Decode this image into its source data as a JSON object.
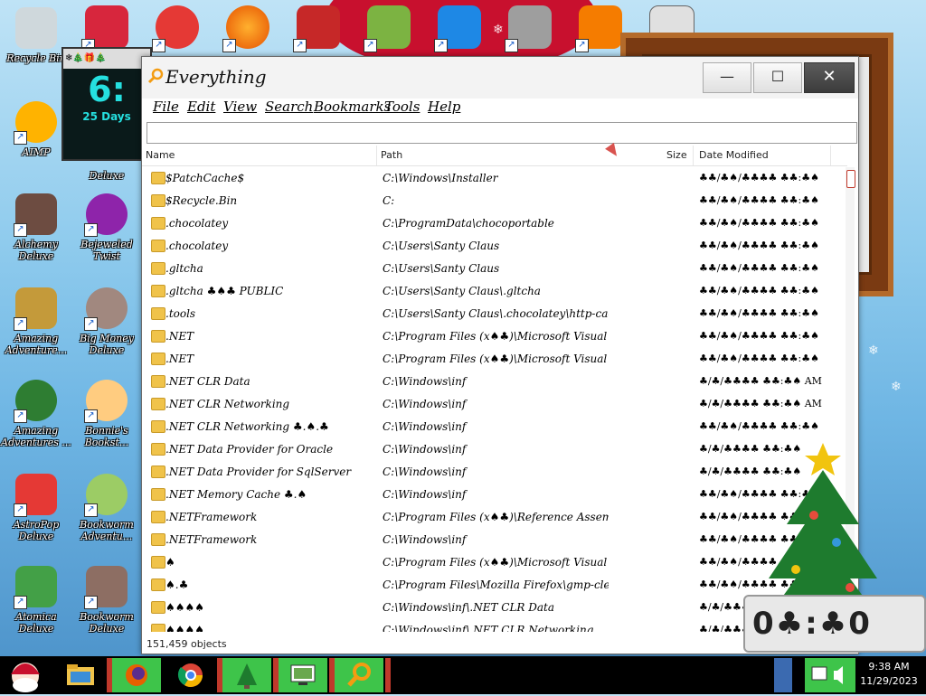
{
  "desktop": {
    "icons": [
      {
        "name": "recycle-bin-icon",
        "label": "Recycle Bin"
      },
      {
        "name": "aimp-icon",
        "label": "AIMP"
      },
      {
        "name": "alchemy-deluxe-icon",
        "label": "Alchemy Deluxe"
      },
      {
        "name": "amazing-adventure-icon",
        "label": "Amazing Adventure..."
      },
      {
        "name": "amazing-adventures2-icon",
        "label": "Amazing Adventures ..."
      },
      {
        "name": "astropop-icon",
        "label": "AstroPop Deluxe"
      },
      {
        "name": "atomica-icon",
        "label": "Atomica Deluxe"
      },
      {
        "name": "bejeweled-twist-icon",
        "label": "Bejeweled Twist"
      },
      {
        "name": "big-money-icon",
        "label": "Big Money Deluxe"
      },
      {
        "name": "bonnies-bookstore-icon",
        "label": "Bonnie's Bookst..."
      },
      {
        "name": "bookworm-adventures-icon",
        "label": "Bookworm Adventu..."
      },
      {
        "name": "bookworm-deluxe-icon",
        "label": "Bookworm Deluxe"
      }
    ],
    "partial_label": "Deluxe"
  },
  "clock_gadget": {
    "bar_glyphs": "❄🎄🎁🎄",
    "number": "6:",
    "days": "25 Days"
  },
  "window": {
    "title": "Everything",
    "minimize": "—",
    "maximize": "☐",
    "close": "✕",
    "menu": [
      "File",
      "Edit",
      "View",
      "Search",
      "Bookmarks",
      "Tools",
      "Help"
    ],
    "search_value": "",
    "columns": {
      "name": "Name",
      "path": "Path",
      "size": "Size",
      "date": "Date Modified"
    },
    "rows": [
      {
        "name": "$PatchCache$",
        "path": "C:\\Windows\\Installer",
        "date": "♣♣/♣♠/♣♣♣♣ ♣♣:♣♠"
      },
      {
        "name": "$Recycle.Bin",
        "path": "C:",
        "date": "♣♣/♣♠/♣♣♣♣ ♣♣:♣♠"
      },
      {
        "name": ".chocolatey",
        "path": "C:\\ProgramData\\chocoportable",
        "date": "♣♣/♣♠/♣♣♣♣ ♣♣:♣♠"
      },
      {
        "name": ".chocolatey",
        "path": "C:\\Users\\Santy Claus",
        "date": "♣♣/♣♠/♣♣♣♣ ♣♣:♣♠"
      },
      {
        "name": ".gltcha",
        "path": "C:\\Users\\Santy Claus",
        "date": "♣♣/♣♠/♣♣♣♣ ♣♣:♣♠"
      },
      {
        "name": ".gltcha ♣♠♣ PUBLIC",
        "path": "C:\\Users\\Santy Claus\\.gltcha",
        "date": "♣♣/♣♠/♣♣♣♣ ♣♣:♣♠"
      },
      {
        "name": ".tools",
        "path": "C:\\Users\\Santy Claus\\.chocolatey\\http-cache",
        "date": "♣♣/♣♠/♣♣♣♣ ♣♣:♣♠"
      },
      {
        "name": ".NET",
        "path": "C:\\Program Files (x♠♣)\\Microsoft Visual Studio ...",
        "date": "♣♣/♣♠/♣♣♣♣ ♣♣:♣♠"
      },
      {
        "name": ".NET",
        "path": "C:\\Program Files (x♠♣)\\Microsoft Visual Studio ...",
        "date": "♣♣/♣♠/♣♣♣♣ ♣♣:♣♠"
      },
      {
        "name": ".NET CLR Data",
        "path": "C:\\Windows\\inf",
        "date": "♣/♣/♣♣♣♣ ♣♣:♣♠ AM"
      },
      {
        "name": ".NET CLR Networking",
        "path": "C:\\Windows\\inf",
        "date": "♣/♣/♣♣♣♣ ♣♣:♣♠ AM"
      },
      {
        "name": ".NET CLR Networking ♣.♠.♣",
        "path": "C:\\Windows\\inf",
        "date": "♣♣/♣♠/♣♣♣♣ ♣♣:♣♠"
      },
      {
        "name": ".NET Data Provider for Oracle",
        "path": "C:\\Windows\\inf",
        "date": "♣/♣/♣♣♣♣ ♣♣:♣♠"
      },
      {
        "name": ".NET Data Provider for SqlServer",
        "path": "C:\\Windows\\inf",
        "date": "♣/♣/♣♣♣♣ ♣♣:♣♠"
      },
      {
        "name": ".NET Memory Cache ♣.♠",
        "path": "C:\\Windows\\inf",
        "date": "♣♣/♣♠/♣♣♣♣ ♣♣:♣♠"
      },
      {
        "name": ".NETFramework",
        "path": "C:\\Program Files (x♠♣)\\Reference Assemblies\\Mi...",
        "date": "♣♣/♣♠/♣♣♣♣ ♣♣:♣♠"
      },
      {
        "name": ".NETFramework",
        "path": "C:\\Windows\\inf",
        "date": "♣♣/♣♠/♣♣♣♣ ♣♣:♣♠"
      },
      {
        "name": "♠",
        "path": "C:\\Program Files (x♠♣)\\Microsoft Visual Studio ...",
        "date": "♣♣/♣♠/♣♣♣♣ ♣♣:♣♠"
      },
      {
        "name": "♠.♣",
        "path": "C:\\Program Files\\Mozilla Firefox\\gmp-clearkey",
        "date": "♣♣/♣♠/♣♣♣♣ ♣♣:♣♠"
      },
      {
        "name": "♠♠♠♠",
        "path": "C:\\Windows\\inf\\.NET CLR Data",
        "date": "♣/♣/♣♣♣♣ ♣♣:♣♠"
      },
      {
        "name": "♠♠♠♠",
        "path": "C:\\Windows\\inf\\.NET CLR Networking",
        "date": "♣/♣/♣♣♣♣ ♣♣:♣♠"
      }
    ],
    "status": "151,459 objects"
  },
  "digital_clock": {
    "digits": "0♣:♣0"
  },
  "taskbar": {
    "time": "9:38 AM",
    "date": "11/29/2023"
  },
  "colors": {
    "taskbar_green": "#3ec44a",
    "santa_red": "#c8102e",
    "close_button": "#4a4a4a"
  }
}
